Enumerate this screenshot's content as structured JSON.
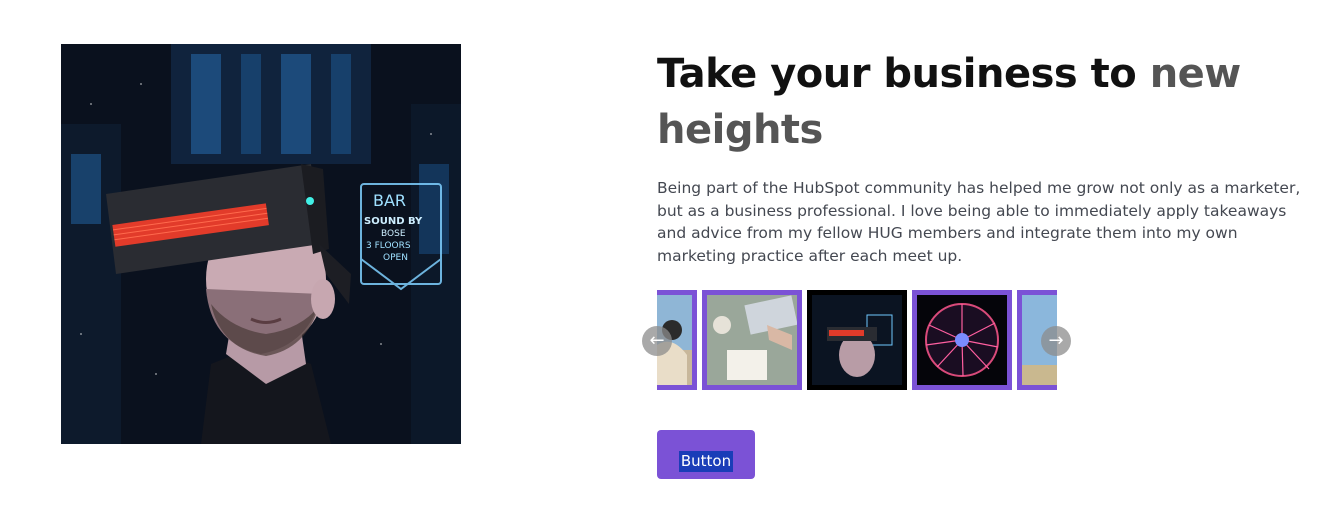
{
  "headline": {
    "text_dark": "Take your business to ",
    "text_accent": "new heights"
  },
  "testimonial": {
    "quote": "Being part of the HubSpot community has helped me grow not only as a marketer, but as a business professional. I love being able to immediately apply takeaways and advice from my fellow HUG members and integrate them into my own marketing practice after each meet up."
  },
  "hero_image": {
    "subject": "Man wearing VR headset in front of neon bar sign",
    "sign_text": [
      "BAR",
      "SOUND BY",
      "BOSE",
      "3 FLOORS",
      "OPEN"
    ]
  },
  "carousel": {
    "prev_icon": "arrow-left-icon",
    "next_icon": "arrow-right-icon",
    "prev_glyph": "←",
    "next_glyph": "→",
    "slides": [
      {
        "subject": "woman with VR headset",
        "active": false
      },
      {
        "subject": "desk with laptop and notebook",
        "active": false
      },
      {
        "subject": "man with VR headset",
        "active": true
      },
      {
        "subject": "plasma ball",
        "active": false
      },
      {
        "subject": "sky",
        "active": false
      }
    ]
  },
  "cta": {
    "label": "Button"
  },
  "colors": {
    "accent_purple": "#7b52d6",
    "headline_dark": "#111111",
    "headline_gray": "#555555",
    "body_text": "#444851",
    "selection_blue": "#1a3db8"
  }
}
